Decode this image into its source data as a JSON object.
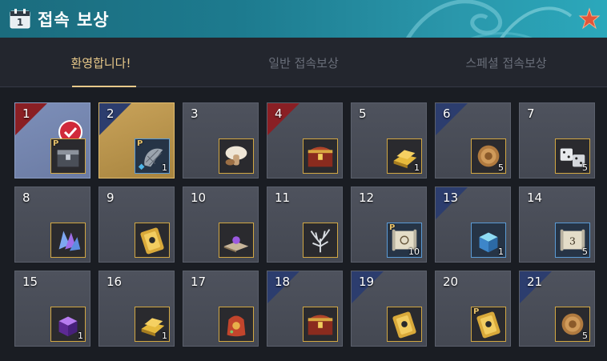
{
  "window": {
    "title": "접속 보상",
    "calendar_day": "1",
    "accent": "#1d7b8f"
  },
  "tabs": [
    {
      "label": "환영합니다!",
      "active": true
    },
    {
      "label": "일반 접속보상",
      "active": false
    },
    {
      "label": "스페셜 접속보상",
      "active": false
    }
  ],
  "rewards": [
    {
      "day": "1",
      "item": "p-chest-icon",
      "qty": "",
      "state": "claimed",
      "corner": "red"
    },
    {
      "day": "2",
      "item": "p-fishing-net-icon",
      "qty": "1",
      "state": "today",
      "corner": "blue"
    },
    {
      "day": "3",
      "item": "mushroom-icon",
      "qty": "",
      "state": "locked",
      "corner": ""
    },
    {
      "day": "4",
      "item": "treasure-chest-icon",
      "qty": "",
      "state": "locked",
      "corner": "red"
    },
    {
      "day": "5",
      "item": "gold-bar-icon",
      "qty": "1",
      "state": "locked",
      "corner": ""
    },
    {
      "day": "6",
      "item": "bronze-coin-icon",
      "qty": "5",
      "state": "locked",
      "corner": "blue"
    },
    {
      "day": "7",
      "item": "dice-icon",
      "qty": "5",
      "state": "locked",
      "corner": ""
    },
    {
      "day": "8",
      "item": "crystal-icon",
      "qty": "",
      "state": "locked",
      "corner": ""
    },
    {
      "day": "9",
      "item": "gold-ticket-icon",
      "qty": "",
      "state": "locked",
      "corner": ""
    },
    {
      "day": "10",
      "item": "spellbook-icon",
      "qty": "",
      "state": "locked",
      "corner": ""
    },
    {
      "day": "11",
      "item": "silver-tree-icon",
      "qty": "",
      "state": "locked",
      "corner": ""
    },
    {
      "day": "12",
      "item": "p-scroll-map-icon",
      "qty": "10",
      "state": "locked",
      "corner": ""
    },
    {
      "day": "13",
      "item": "blue-crystal-box-icon",
      "qty": "1",
      "state": "locked",
      "corner": "blue"
    },
    {
      "day": "14",
      "item": "scroll-3-icon",
      "qty": "5",
      "state": "locked",
      "corner": ""
    },
    {
      "day": "15",
      "item": "purple-cube-icon",
      "qty": "1",
      "state": "locked",
      "corner": ""
    },
    {
      "day": "16",
      "item": "gold-bar-icon",
      "qty": "1",
      "state": "locked",
      "corner": ""
    },
    {
      "day": "17",
      "item": "red-bag-icon",
      "qty": "",
      "state": "locked",
      "corner": ""
    },
    {
      "day": "18",
      "item": "treasure-chest-icon",
      "qty": "",
      "state": "locked",
      "corner": "blue"
    },
    {
      "day": "19",
      "item": "gold-ticket-icon",
      "qty": "",
      "state": "locked",
      "corner": "blue"
    },
    {
      "day": "20",
      "item": "p-gold-ticket-icon",
      "qty": "",
      "state": "locked",
      "corner": ""
    },
    {
      "day": "21",
      "item": "bronze-coin-icon",
      "qty": "5",
      "state": "locked",
      "corner": "blue"
    }
  ]
}
